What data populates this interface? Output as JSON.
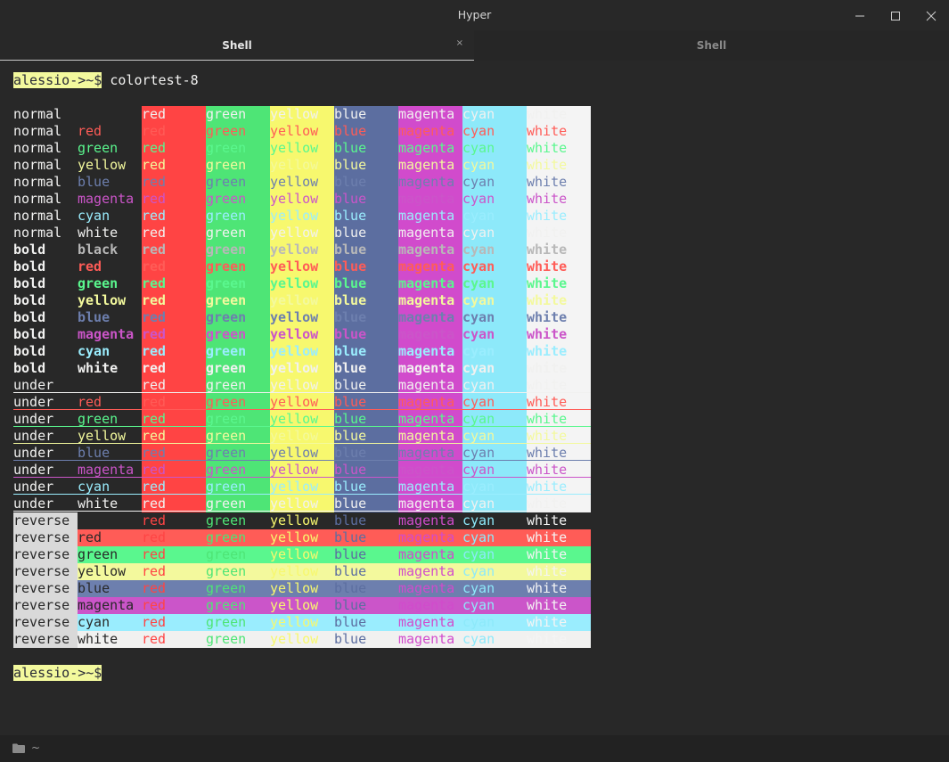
{
  "window": {
    "title": "Hyper"
  },
  "tabs": [
    {
      "label": "Shell",
      "close": "×"
    },
    {
      "label": "Shell"
    }
  ],
  "terminal": {
    "prompt": "alessio->~$",
    "command": " colortest-8"
  },
  "palette": {
    "black": "#000000",
    "red": "#ff5c57",
    "green": "#5af78e",
    "yellow": "#f3f99d",
    "blue": "#57c7ff",
    "magenta": "#ff6ac1",
    "cyan": "#9aedfe",
    "white": "#f1f1f0",
    "bg_red": "#ff4444",
    "bg_green": "#4ee576",
    "bg_yellow": "#f7f86e",
    "bg_blue": "#5c6ea0",
    "bg_magenta": "#d14bcc",
    "bg_cyan": "#8de9fa",
    "bg_white": "#f4f4f4",
    "fg_blue": "#6d7fae",
    "fg_magenta": "#cb55c9",
    "term_bg": "#282828",
    "term_fg": "#f1f1f0",
    "bold_black": "#b8b8b8"
  },
  "colortest": {
    "styles": [
      "normal",
      "bold",
      "under",
      "reverse"
    ],
    "colors": [
      "",
      "red",
      "green",
      "yellow",
      "blue",
      "magenta",
      "cyan",
      "white"
    ],
    "bold_black_label": "black",
    "bg_labels": [
      "red",
      "green",
      "yellow",
      "blue",
      "magenta",
      "cyan",
      "white"
    ]
  },
  "status": {
    "icon": "folder-icon",
    "path": "~"
  }
}
